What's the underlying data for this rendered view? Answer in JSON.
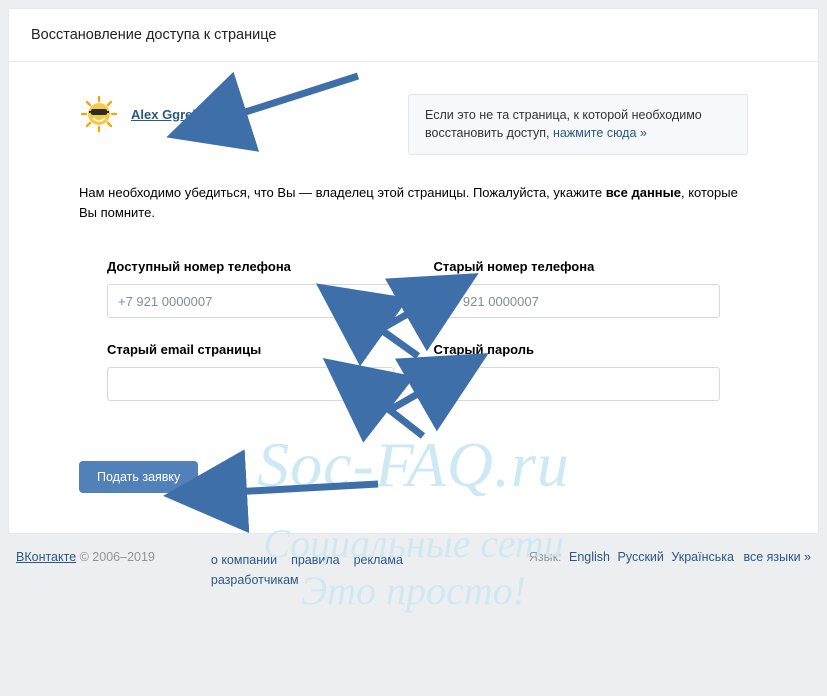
{
  "header": {
    "title": "Восстановление доступа к странице"
  },
  "profile": {
    "name": "Alex Ggrelaxi"
  },
  "hint": {
    "text": "Если это не та страница, к которой необходимо восстановить доступ, ",
    "link": "нажмите сюда »"
  },
  "instruction": {
    "prefix": "Нам необходимо убедиться, что Вы — владелец этой страницы. Пожалуйста, укажите ",
    "bold": "все данные",
    "suffix": ", которые Вы помните."
  },
  "fields": {
    "available_phone": {
      "label": "Доступный номер телефона",
      "placeholder": "+7 921 0000007"
    },
    "old_phone": {
      "label": "Старый номер телефона",
      "placeholder": "+7 921 0000007"
    },
    "old_email": {
      "label": "Старый email страницы",
      "placeholder": ""
    },
    "old_password": {
      "label": "Старый пароль",
      "placeholder": ""
    }
  },
  "submit": {
    "label": "Подать заявку"
  },
  "footer": {
    "brand": "ВКонтакте",
    "copyright": " © 2006–2019",
    "nav": {
      "about": "о компании",
      "rules": "правила",
      "ads": "реклама",
      "devs": "разработчикам"
    },
    "lang": {
      "label": "Язык:",
      "en": "English",
      "ru": "Русский",
      "uk": "Українська",
      "all": "все языки »"
    }
  },
  "watermark": {
    "line1": "Soc-FAQ.ru",
    "line2": "Социальные сети",
    "line3": "Это просто!"
  }
}
